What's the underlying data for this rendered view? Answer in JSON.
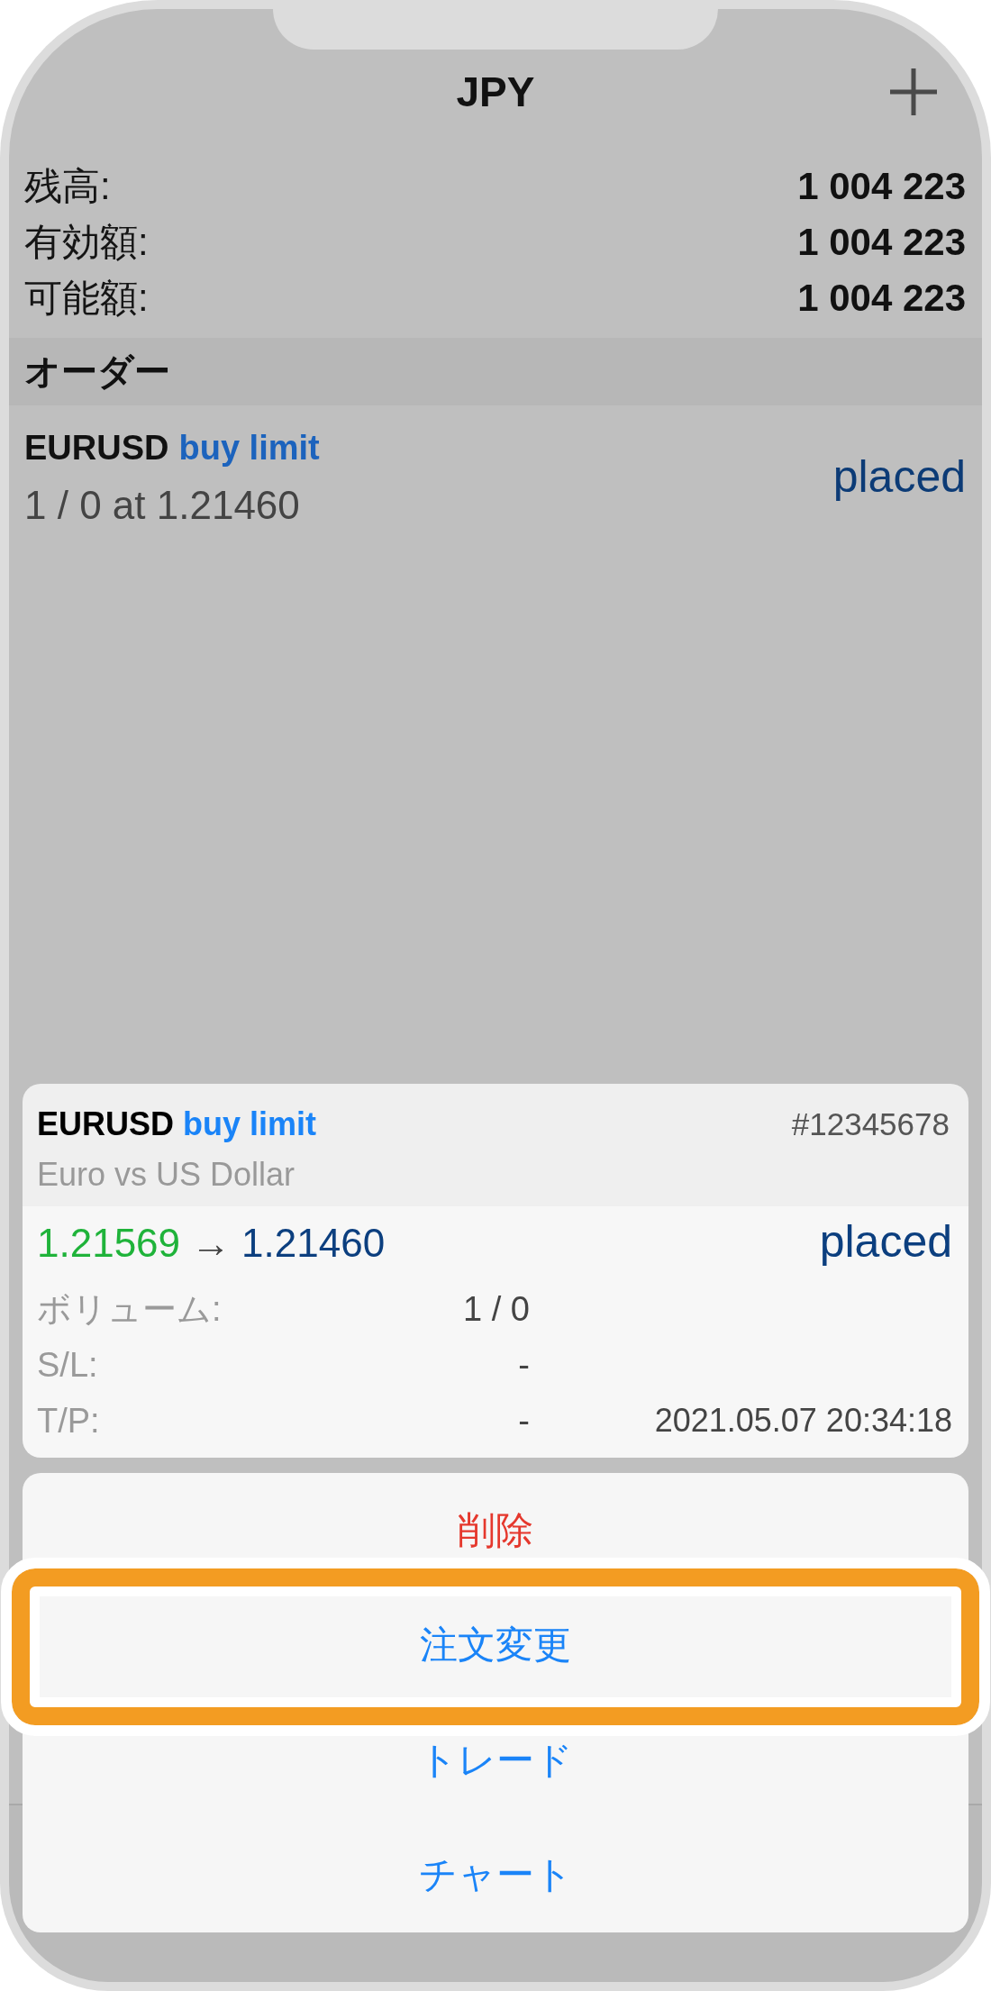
{
  "nav_bar": {
    "title": "JPY"
  },
  "account_summary": [
    {
      "label": "残高:",
      "value": "1 004 223"
    },
    {
      "label": "有効額:",
      "value": "1 004 223"
    },
    {
      "label": "可能額:",
      "value": "1 004 223"
    }
  ],
  "orders_section": {
    "title": "オーダー",
    "orders": [
      {
        "symbol": "EURUSD",
        "type": "buy limit",
        "details": "1 / 0 at 1.21460",
        "status": "placed"
      }
    ]
  },
  "order_card": {
    "symbol": "EURUSD",
    "type": "buy limit",
    "ticket": "#12345678",
    "description": "Euro vs US Dollar",
    "open_price": "1.21569",
    "arrow": "→",
    "current_price": "1.21460",
    "status": "placed",
    "rows": [
      {
        "label": "ボリューム:",
        "value": "1 / 0"
      },
      {
        "label": "S/L:",
        "value": "-"
      },
      {
        "label": "T/P:",
        "value": "-"
      }
    ],
    "time": "2021.05.07 20:34:18"
  },
  "action_sheet": {
    "items": [
      {
        "label": "削除",
        "kind": "destructive",
        "highlighted": false
      },
      {
        "label": "注文変更",
        "kind": "default",
        "highlighted": true
      },
      {
        "label": "トレード",
        "kind": "default",
        "highlighted": false
      },
      {
        "label": "チャート",
        "kind": "default",
        "highlighted": false
      }
    ]
  }
}
